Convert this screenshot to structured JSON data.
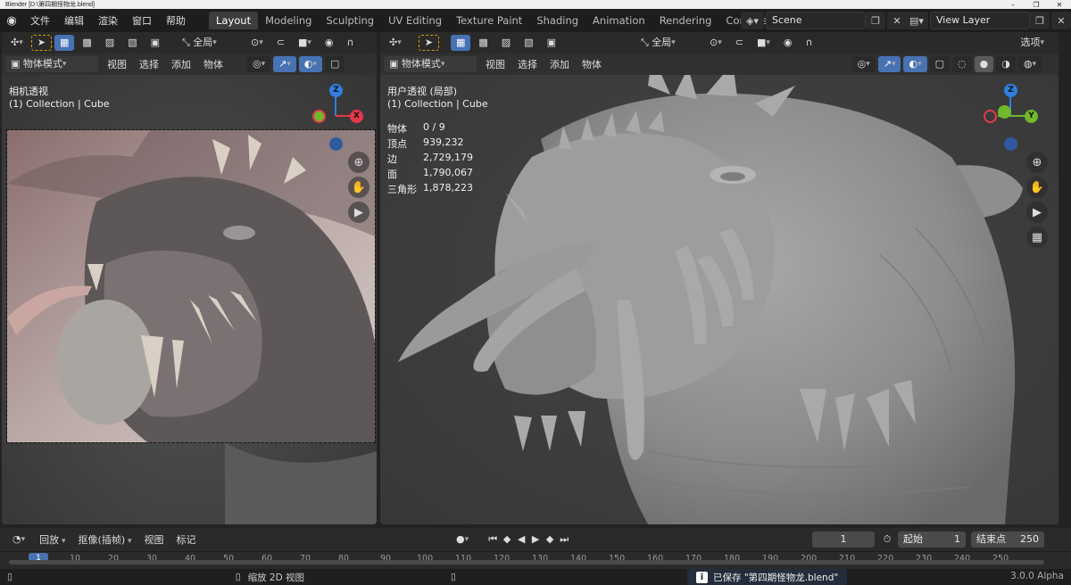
{
  "window": {
    "title": "Blender [D:\\第四期怪物龙.blend]"
  },
  "menubar": {
    "items": [
      "文件",
      "编辑",
      "渲染",
      "窗口",
      "帮助"
    ]
  },
  "workspaces": {
    "tabs": [
      "Layout",
      "Modeling",
      "Sculpting",
      "UV Editing",
      "Texture Paint",
      "Shading",
      "Animation",
      "Rendering",
      "Compositing"
    ],
    "active": "Layout"
  },
  "scene": {
    "name": "Scene",
    "view_layer": "View Layer"
  },
  "left_view": {
    "transform_orientation": "全局",
    "mode": "物体模式",
    "menus": [
      "视图",
      "选择",
      "添加",
      "物体"
    ],
    "title": "相机透视",
    "collection": "(1) Collection | Cube"
  },
  "right_view": {
    "transform_orientation": "全局",
    "options_label": "选项",
    "mode": "物体模式",
    "menus": [
      "视图",
      "选择",
      "添加",
      "物体"
    ],
    "title": "用户透视 (局部)",
    "collection": "(1) Collection | Cube",
    "stats": [
      {
        "label": "物体",
        "value": "0 / 9"
      },
      {
        "label": "顶点",
        "value": "939,232"
      },
      {
        "label": "边",
        "value": "2,729,179"
      },
      {
        "label": "面",
        "value": "1,790,067"
      },
      {
        "label": "三角形",
        "value": "1,878,223"
      }
    ]
  },
  "gizmo": {
    "z": "Z",
    "x": "X",
    "y": "Y"
  },
  "timeline": {
    "playback": "回放",
    "keying": "抠像(插帧)",
    "menus": [
      "视图",
      "标记"
    ],
    "current_frame": "1",
    "start_label": "起始",
    "start": "1",
    "end_label": "结束点",
    "end": "250",
    "ruler": [
      "1",
      "10",
      "20",
      "30",
      "40",
      "50",
      "60",
      "70",
      "80",
      "90",
      "100",
      "110",
      "120",
      "130",
      "140",
      "150",
      "160",
      "170",
      "180",
      "190",
      "200",
      "210",
      "220",
      "230",
      "240",
      "250"
    ]
  },
  "status": {
    "hint": "缩放 2D 视图",
    "message": "已保存 \"第四期怪物龙.blend\"",
    "version": "3.0.0 Alpha"
  },
  "colors": {
    "accent": "#4772b3",
    "x_axis": "#e6394a",
    "y_axis": "#6fb92b",
    "z_axis": "#2f7fe0"
  }
}
